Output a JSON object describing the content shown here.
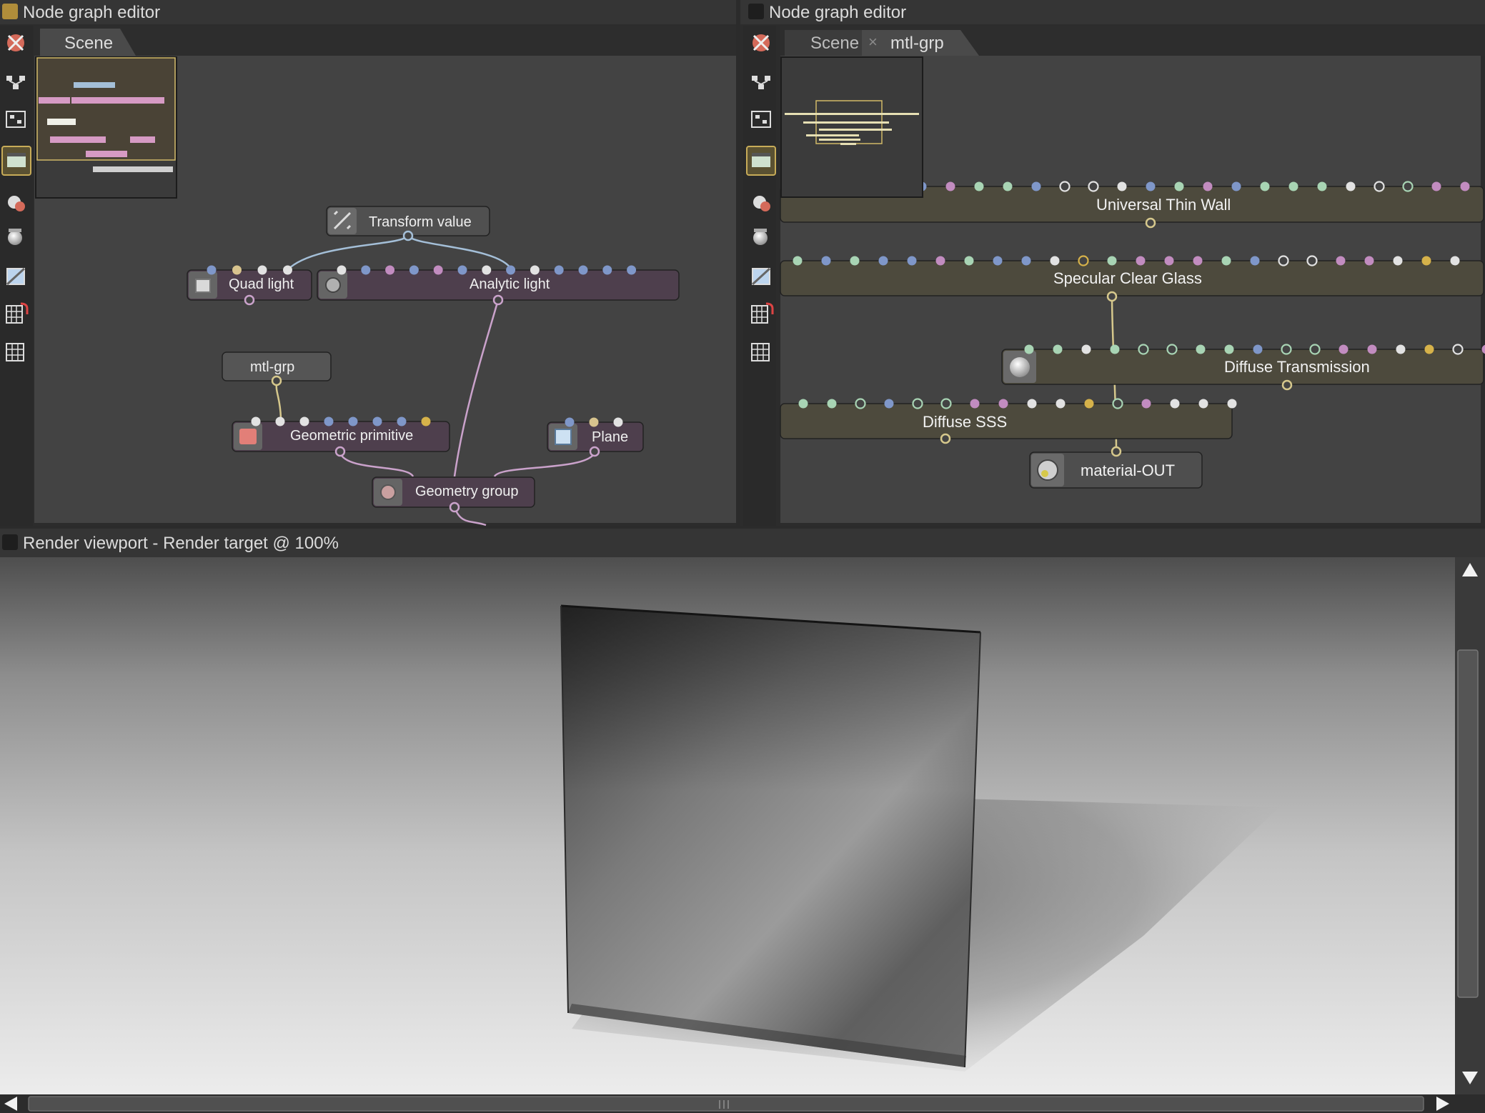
{
  "left_panel": {
    "title": "Node graph editor",
    "tab": "Scene"
  },
  "right_panel": {
    "title": "Node graph editor",
    "tabs": [
      "Scene",
      "mtl-grp"
    ],
    "close_glyph": "×"
  },
  "left_nodes": {
    "transform": "Transform value",
    "quad": "Quad light",
    "analytic": "Analytic light",
    "mtlgrp": "mtl-grp",
    "geoprim": "Geometric primitive",
    "plane": "Plane",
    "geogroup": "Geometry group"
  },
  "right_nodes": {
    "utw": "Universal Thin Wall",
    "scg": "Specular Clear Glass",
    "dt": "Diffuse Transmission",
    "dsss": "Diffuse SSS",
    "mout": "material-OUT"
  },
  "viewport": {
    "title": "Render viewport - Render target @ 100%"
  },
  "toolbar_icons": [
    "scene-icon",
    "layout-icon",
    "arrange-icon",
    "camera-icon",
    "material-icon",
    "sphere-icon",
    "texture-icon",
    "magnet-grid-icon",
    "grid-icon"
  ],
  "colors": {
    "pin_blue": "#7f97c9",
    "pin_pink": "#c28cc0",
    "pin_green": "#a8d4b4",
    "pin_white": "#e2e2e2",
    "pin_yellow": "#d6b24a",
    "pin_beige": "#d8c48e",
    "link_pink": "#caa2cb",
    "link_blue": "#a4bfd8",
    "link_yellow": "#d6c88c",
    "node_purple": "#4e3f4d",
    "node_olive": "#4d4a3d",
    "node_gray": "#4e4e4e"
  }
}
